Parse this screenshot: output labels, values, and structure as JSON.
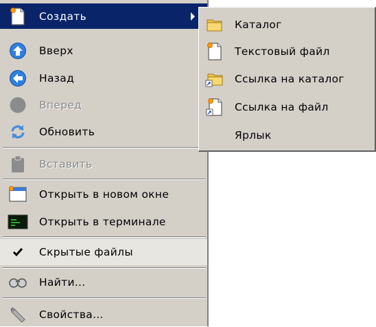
{
  "menu": {
    "items": [
      {
        "label": "Создать",
        "icon": "new-file-icon"
      },
      {
        "label": "Вверх",
        "icon": "up-arrow-icon"
      },
      {
        "label": "Назад",
        "icon": "back-arrow-icon"
      },
      {
        "label": "Вперед",
        "icon": "forward-arrow-icon"
      },
      {
        "label": "Обновить",
        "icon": "refresh-icon"
      },
      {
        "label": "Вставить",
        "icon": "paste-icon"
      },
      {
        "label": "Открыть в новом окне",
        "icon": "new-window-icon"
      },
      {
        "label": "Открыть в терминале",
        "icon": "terminal-icon"
      },
      {
        "label": "Скрытые файлы",
        "icon": "checkmark-icon",
        "checked": true
      },
      {
        "label": "Найти...",
        "icon": "binoculars-icon"
      },
      {
        "label": "Свойства...",
        "icon": "wrench-icon"
      }
    ]
  },
  "submenu": {
    "items": [
      {
        "label": "Каталог",
        "icon": "folder-icon"
      },
      {
        "label": "Текстовый файл",
        "icon": "text-file-icon"
      },
      {
        "label": "Ссылка на каталог",
        "icon": "folder-link-icon"
      },
      {
        "label": "Ссылка на файл",
        "icon": "file-link-icon"
      },
      {
        "label": "Ярлык",
        "icon": ""
      }
    ]
  },
  "colors": {
    "menu_bg": "#d4d0c8",
    "selection": "#0a246a",
    "disabled_text": "#8a8a8a"
  }
}
